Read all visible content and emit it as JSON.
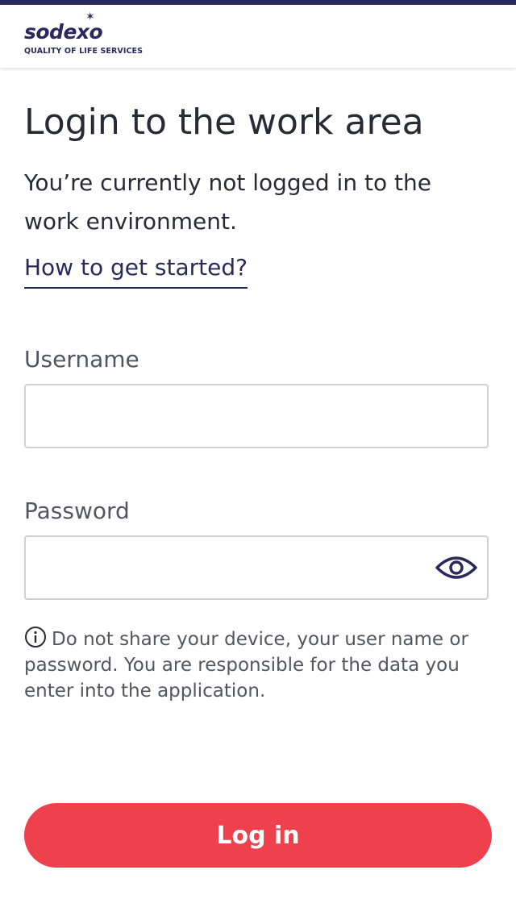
{
  "header": {
    "logo_word": "sodexo",
    "logo_tagline": "QUALITY OF LIFE SERVICES"
  },
  "main": {
    "title": "Login to the work area",
    "subtitle": "You’re currently not logged in to the work environment.",
    "help_link": "How to get started?"
  },
  "form": {
    "username_label": "Username",
    "username_value": "",
    "password_label": "Password",
    "password_value": "",
    "notice": "Do not share your device, your user name or password. You are responsible for the data you enter into the application.",
    "login_label": "Log in"
  },
  "icons": {
    "show_password": "eye-icon",
    "notice": "info-icon"
  },
  "colors": {
    "brand": "#2a295c",
    "accent": "#ef404d",
    "text": "#2a2a36",
    "muted_text": "#55555f",
    "input_border": "#d0d0d6"
  }
}
